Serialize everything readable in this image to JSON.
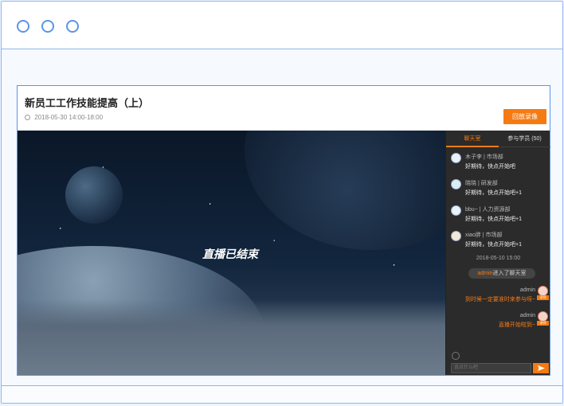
{
  "page": {
    "title": "新员工工作技能提高（上）",
    "time": "2018-05-30 14:00-18:00",
    "replay_button": "回放录像"
  },
  "video": {
    "status_text": "直播已结束"
  },
  "chat": {
    "tabs": [
      "聊天室",
      "参与学员 (50)"
    ],
    "messages": [
      {
        "name": "木子李 | 市场部",
        "text": "好期待，快点开始吧"
      },
      {
        "name": "晓晓 | 研发部",
        "text": "好期待，快点开始吧+1"
      },
      {
        "name": "bbu~ | 人力资源部",
        "text": "好期待，快点开始吧+1"
      },
      {
        "name": "xiao胖 | 市场部",
        "text": "好期待，快点开始吧+1"
      }
    ],
    "timestamp": "2018-05-10 15:00",
    "join_user": "admin",
    "join_text": "进入了聊天室",
    "admin_messages": [
      {
        "name": "admin",
        "text": "到时候一定要准时来参与呀~"
      },
      {
        "name": "admin",
        "text": "直播开始啦到~"
      }
    ],
    "admin_tag": "讲师",
    "input_placeholder": "说点什么吧"
  }
}
